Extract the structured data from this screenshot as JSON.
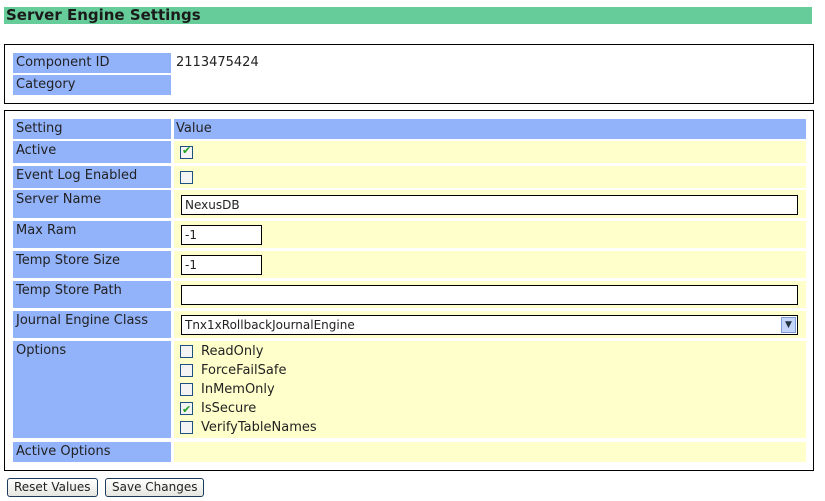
{
  "title": "Server Engine Settings",
  "info": {
    "component_id_label": "Component ID",
    "component_id": "2113475424",
    "category_label": "Category",
    "category": ""
  },
  "settings": {
    "header_setting": "Setting",
    "header_value": "Value",
    "active_label": "Active",
    "active": true,
    "event_log_label": "Event Log Enabled",
    "event_log": false,
    "server_name_label": "Server Name",
    "server_name": "NexusDB",
    "max_ram_label": "Max Ram",
    "max_ram": "-1",
    "temp_store_size_label": "Temp Store Size",
    "temp_store_size": "-1",
    "temp_store_path_label": "Temp Store Path",
    "temp_store_path": "",
    "journal_label": "Journal Engine Class",
    "journal": "Tnx1xRollbackJournalEngine",
    "options_label": "Options",
    "options": [
      {
        "label": "ReadOnly",
        "checked": false
      },
      {
        "label": "ForceFailSafe",
        "checked": false
      },
      {
        "label": "InMemOnly",
        "checked": false
      },
      {
        "label": "IsSecure",
        "checked": true
      },
      {
        "label": "VerifyTableNames",
        "checked": false
      }
    ],
    "active_options_label": "Active Options"
  },
  "buttons": {
    "reset": "Reset Values",
    "save": "Save Changes"
  }
}
